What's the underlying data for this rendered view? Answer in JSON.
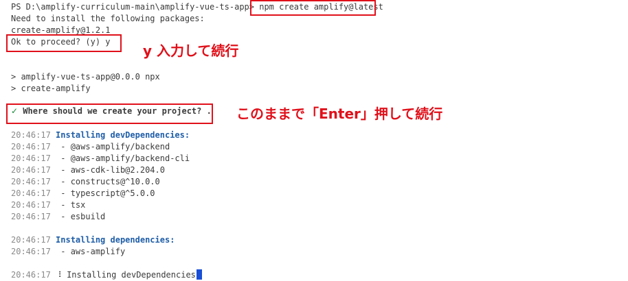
{
  "terminal": {
    "prompt": "PS D:\\amplify-curriculum-main\\amplify-vue-ts-app> ",
    "command": "npm create amplify@latest",
    "need_install": "Need to install the following packages:",
    "package": "create-amplify@1.2.1",
    "proceed": "Ok to proceed? (y) y",
    "npx_line1": "> amplify-vue-ts-app@0.0.0 npx",
    "npx_line2": "> create-amplify",
    "check_mark": "✓",
    "where_question": "Where should we create your project? .",
    "time": "20:46:17",
    "installing_dev_label": "Installing devDependencies:",
    "dev_dependencies": [
      "- @aws-amplify/backend",
      "- @aws-amplify/backend-cli",
      "- aws-cdk-lib@2.204.0",
      "- constructs@^10.0.0",
      "- typescript@^5.0.0",
      "- tsx",
      "- esbuild"
    ],
    "installing_deps_label": "Installing dependencies:",
    "dependencies": [
      "- aws-amplify"
    ],
    "spinner": "⠸",
    "status_line": "Installing devDependencies"
  },
  "annotations": {
    "enter_y": "y 入力して続行",
    "press_enter": "このままで「Enter」押して続行"
  },
  "colors": {
    "annotation_red": "#e0101a",
    "info_blue": "#1f5ea8",
    "check_green": "#1a8d3a",
    "cursor_blue": "#1a4fd6"
  }
}
